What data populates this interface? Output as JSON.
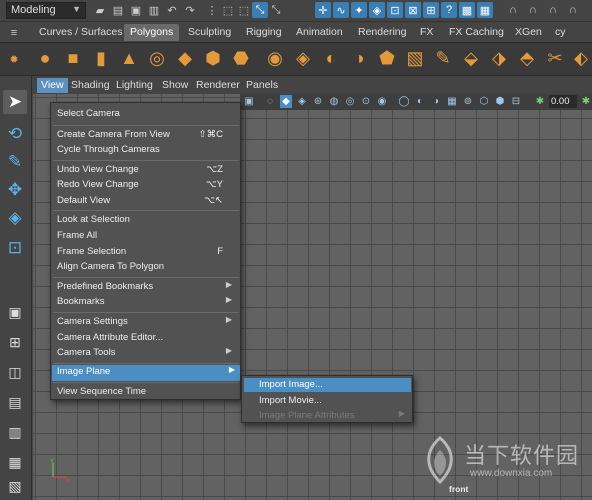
{
  "top": {
    "mode": "Modeling",
    "field_value": "0.00"
  },
  "shelf_tabs": [
    "Curves / Surfaces",
    "Polygons",
    "Sculpting",
    "Rigging",
    "Animation",
    "Rendering",
    "FX",
    "FX Caching",
    "XGen",
    "cy"
  ],
  "active_shelf_tab": "Polygons",
  "panel_menu": [
    "View",
    "Shading",
    "Lighting",
    "Show",
    "Renderer",
    "Panels"
  ],
  "view_menu": {
    "items": [
      {
        "label": "Select Camera",
        "shortcut": ""
      },
      {
        "label": "Create Camera From View",
        "shortcut": "⇧⌘C"
      },
      {
        "label": "Cycle Through Cameras",
        "shortcut": ""
      },
      {
        "label": "Undo View Change",
        "shortcut": "⌥Z"
      },
      {
        "label": "Redo View Change",
        "shortcut": "⌥Y"
      },
      {
        "label": "Default View",
        "shortcut": "⌥↖"
      },
      {
        "label": "Look at Selection",
        "shortcut": ""
      },
      {
        "label": "Frame All",
        "shortcut": ""
      },
      {
        "label": "Frame Selection",
        "shortcut": "F"
      },
      {
        "label": "Align Camera To Polygon",
        "shortcut": ""
      },
      {
        "label": "Predefined Bookmarks",
        "shortcut": ""
      },
      {
        "label": "Bookmarks",
        "shortcut": ""
      },
      {
        "label": "Camera Settings",
        "shortcut": ""
      },
      {
        "label": "Camera Attribute Editor...",
        "shortcut": ""
      },
      {
        "label": "Camera Tools",
        "shortcut": ""
      },
      {
        "label": "Image Plane",
        "shortcut": ""
      },
      {
        "label": "View Sequence Time",
        "shortcut": ""
      }
    ]
  },
  "image_plane_submenu": {
    "items": [
      {
        "label": "Import Image..."
      },
      {
        "label": "Import Movie..."
      },
      {
        "label": "Image Plane Attributes"
      }
    ]
  },
  "viewport": {
    "camera_label": "front"
  },
  "watermark": {
    "brand": "当下软件园",
    "url": "www.downxia.com"
  },
  "colors": {
    "accent": "#4a8ec3",
    "shelf_icon": "#e39a3a",
    "tool_icon": "#5ab2e8"
  }
}
